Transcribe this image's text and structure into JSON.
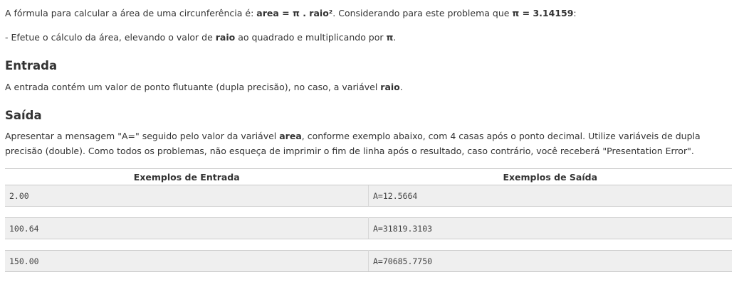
{
  "statement": {
    "p1_a": "A fórmula para calcular a área de uma circunferência é: ",
    "p1_formula": "area = π . raio²",
    "p1_b": ". Considerando para este problema que ",
    "p1_pi": "π = 3.14159",
    "p1_c": ":",
    "p2_a": "- Efetue o cálculo da área, elevando o valor de ",
    "p2_raio": "raio",
    "p2_b": " ao quadrado e multiplicando por ",
    "p2_pi": "π",
    "p2_c": "."
  },
  "entrada": {
    "heading": "Entrada",
    "text_a": "A entrada contém um valor de ponto flutuante (dupla precisão), no caso, a variável ",
    "text_raio": "raio",
    "text_b": "."
  },
  "saida": {
    "heading": "Saída",
    "text_a": "Apresentar a mensagem \"A=\" seguido pelo valor da variável ",
    "text_area": "area",
    "text_b": ", conforme exemplo abaixo, com 4 casas após o ponto decimal. Utilize variáveis de dupla precisão (double). Como todos os problemas, não esqueça de imprimir o fim de linha após o resultado, caso contrário, você receberá \"Presentation Error\"."
  },
  "examples": {
    "header_input": "Exemplos de Entrada",
    "header_output": "Exemplos de Saída",
    "rows": [
      {
        "input": "2.00",
        "output": "A=12.5664"
      },
      {
        "input": "100.64",
        "output": "A=31819.3103"
      },
      {
        "input": "150.00",
        "output": "A=70685.7750"
      }
    ]
  }
}
